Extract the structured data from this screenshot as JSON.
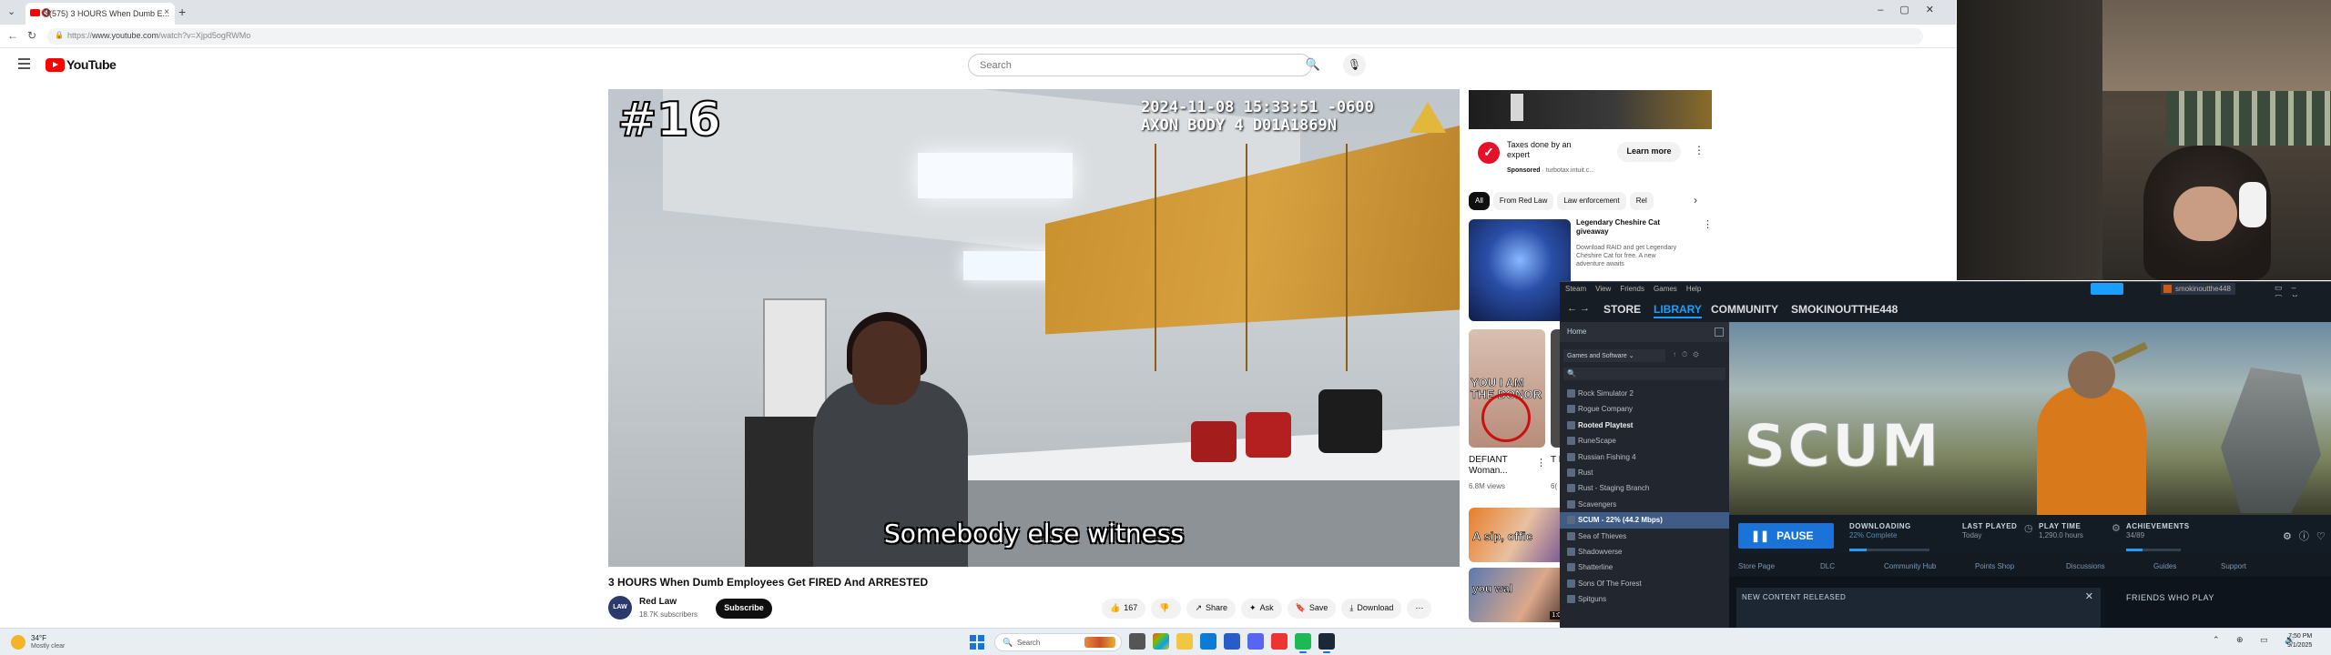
{
  "browser": {
    "tab_title": "(575) 3 HOURS When Dumb E...",
    "tab_close": "×",
    "new_tab": "+",
    "url_prefix": "https://",
    "url_main": "www.youtube.com",
    "url_path": "/watch?v=Xjpd5ogRWMo",
    "icons": [
      "chevron-down-icon",
      "youtube-favicon",
      "mute-icon",
      "back-arrow-icon",
      "reload-icon",
      "lock-icon"
    ]
  },
  "youtube": {
    "logo_text": "YouTube",
    "search_placeholder": "Search",
    "icons": [
      "hamburger-menu-icon",
      "search-icon",
      "microphone-icon"
    ]
  },
  "video": {
    "overlay_episode": "#16",
    "overlay_timestamp": "2024-11-08 15:33:51 -0600\nAXON BODY 4 D01A1869N",
    "caption": "Somebody else witness",
    "title": "3 HOURS When Dumb Employees Get FIRED And ARRESTED",
    "channel_name": "Red Law",
    "channel_avatar_text": "LAW",
    "subscribers": "18.7K subscribers",
    "subscribe_label": "Subscribe",
    "actions": [
      {
        "icon": "👍",
        "label": "167"
      },
      {
        "icon": "👎",
        "label": ""
      },
      {
        "icon": "↗",
        "label": "Share"
      },
      {
        "icon": "✦",
        "label": "Ask"
      },
      {
        "icon": "🔖",
        "label": "Save"
      },
      {
        "icon": "⤓",
        "label": "Download"
      },
      {
        "icon": "⋯",
        "label": ""
      }
    ]
  },
  "sidebar": {
    "ad": {
      "title": "Taxes done by an expert",
      "sponsored": "Sponsored",
      "advertiser": "· turbotax.intuit.c...",
      "cta": "Learn more"
    },
    "chips": [
      "All",
      "From Red Law",
      "Law enforcement",
      "Rel"
    ],
    "rec1": {
      "title": "Legendary Cheshire Cat giveaway",
      "desc": "Download RAID and get Legendary Cheshire Cat for free. A new adventure awaits"
    },
    "short1": {
      "thumb_text": "YOU I AM THE DONOR",
      "title": "DEFIANT Woman...",
      "views": "6.8M views"
    },
    "short2": {
      "title": "T E",
      "views": "6("
    },
    "rec2": {
      "thumb_text": "A sip, offic"
    },
    "rec3": {
      "thumb_text": "you wal",
      "duration": "1:04:"
    }
  },
  "steam": {
    "menu": [
      "Steam",
      "View",
      "Friends",
      "Games",
      "Help"
    ],
    "username": "smokinoutthe448",
    "nav": [
      "STORE",
      "LIBRARY",
      "COMMUNITY",
      "SMOKINOUTTHE448"
    ],
    "sidebar_home": "Home",
    "filter_label": "Games and Software",
    "games": [
      {
        "name": "Rock Simulator 2",
        "bold": false
      },
      {
        "name": "Rogue Company",
        "bold": false
      },
      {
        "name": "Rooted Playtest",
        "bold": true
      },
      {
        "name": "RuneScape",
        "bold": false
      },
      {
        "name": "Russian Fishing 4",
        "bold": false
      },
      {
        "name": "Rust",
        "bold": false
      },
      {
        "name": "Rust - Staging Branch",
        "bold": false
      },
      {
        "name": "Scavengers",
        "bold": false
      },
      {
        "name": "SCUM - 22% (44.2 Mbps)",
        "bold": true
      },
      {
        "name": "Sea of Thieves",
        "bold": false
      },
      {
        "name": "Shadowverse",
        "bold": false
      },
      {
        "name": "Shatterline",
        "bold": false
      },
      {
        "name": "Sons Of The Forest",
        "bold": false
      },
      {
        "name": "Spitguns",
        "bold": false
      }
    ],
    "game_logo": "SCUM",
    "pause_label": "PAUSE",
    "downloading_label": "DOWNLOADING",
    "downloading_sub": "22% Complete",
    "downloading_progress": 0.22,
    "last_played_label": "LAST PLAYED",
    "last_played_value": "Today",
    "play_time_label": "PLAY TIME",
    "play_time_value": "1,290.0 hours",
    "achievements_label": "ACHIEVEMENTS",
    "achievements_value": "34/89",
    "subnav": [
      "Store Page",
      "DLC",
      "Community Hub",
      "Points Shop",
      "Discussions",
      "Guides",
      "Support"
    ],
    "content_header": "NEW CONTENT RELEASED",
    "friends_header": "FRIENDS WHO PLAY"
  },
  "taskbar": {
    "temp": "34°F",
    "weather": "Mostly clear",
    "search_placeholder": "Search",
    "time": "7:50 PM",
    "date": "9/1/2025"
  }
}
